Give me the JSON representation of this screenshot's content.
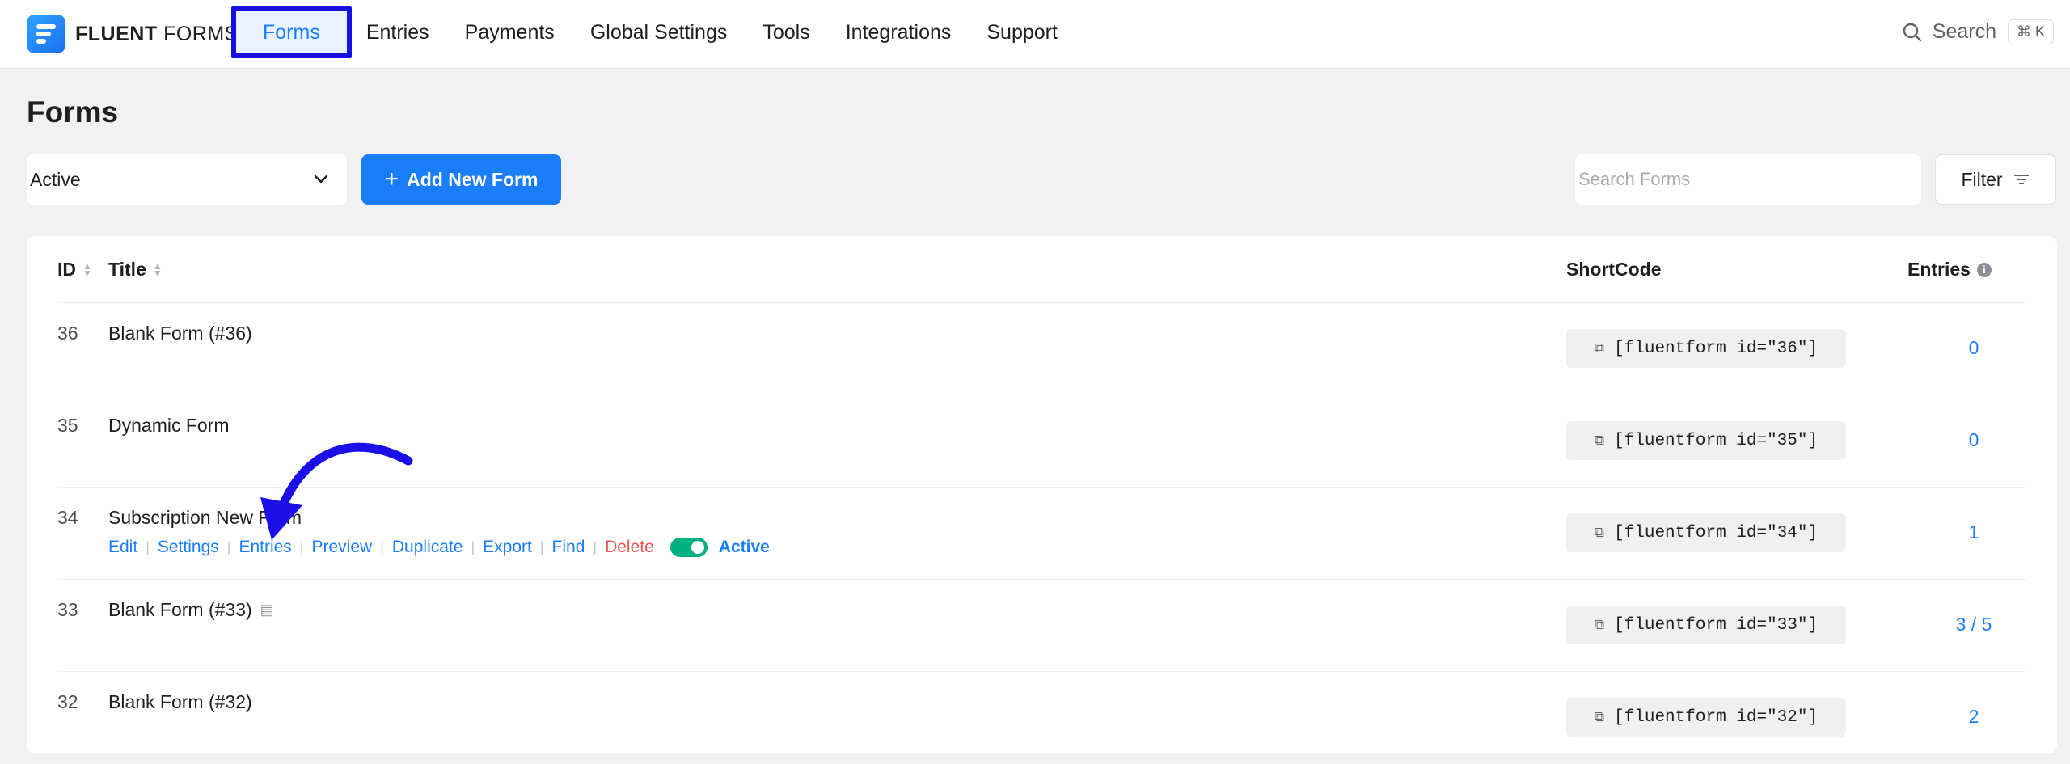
{
  "brand": {
    "name_bold": "FLUENT",
    "name_light": "FORMS"
  },
  "nav": {
    "items": [
      {
        "label": "Forms",
        "active": true
      },
      {
        "label": "Entries"
      },
      {
        "label": "Payments"
      },
      {
        "label": "Global Settings"
      },
      {
        "label": "Tools"
      },
      {
        "label": "Integrations"
      },
      {
        "label": "Support"
      }
    ],
    "search_label": "Search",
    "search_shortcut": "⌘ K"
  },
  "page": {
    "title": "Forms"
  },
  "controls": {
    "status_value": "Active",
    "add_button": "Add New Form",
    "search_placeholder": "Search Forms",
    "filter_label": "Filter"
  },
  "table": {
    "headers": {
      "id": "ID",
      "title": "Title",
      "shortcode": "ShortCode",
      "entries": "Entries"
    },
    "rows": [
      {
        "id": "36",
        "title": "Blank Form (#36)",
        "shortcode": "[fluentform id=\"36\"]",
        "entries": "0"
      },
      {
        "id": "35",
        "title": "Dynamic Form",
        "shortcode": "[fluentform id=\"35\"]",
        "entries": "0"
      },
      {
        "id": "34",
        "title": "Subscription New Form",
        "shortcode": "[fluentform id=\"34\"]",
        "entries": "1"
      },
      {
        "id": "33",
        "title": "Blank Form (#33)",
        "shortcode": "[fluentform id=\"33\"]",
        "entries": "3 / 5"
      },
      {
        "id": "32",
        "title": "Blank Form (#32)",
        "shortcode": "[fluentform id=\"32\"]",
        "entries": "2"
      }
    ],
    "row_actions": {
      "edit": "Edit",
      "settings": "Settings",
      "entries": "Entries",
      "preview": "Preview",
      "duplicate": "Duplicate",
      "export": "Export",
      "find": "Find",
      "delete": "Delete",
      "status": "Active"
    }
  },
  "colors": {
    "accent": "#1a7efb",
    "highlight_border": "#1610e6",
    "annotation_arrow": "#1b0ee8",
    "toggle_on": "#00b27f",
    "danger": "#ef5350"
  }
}
